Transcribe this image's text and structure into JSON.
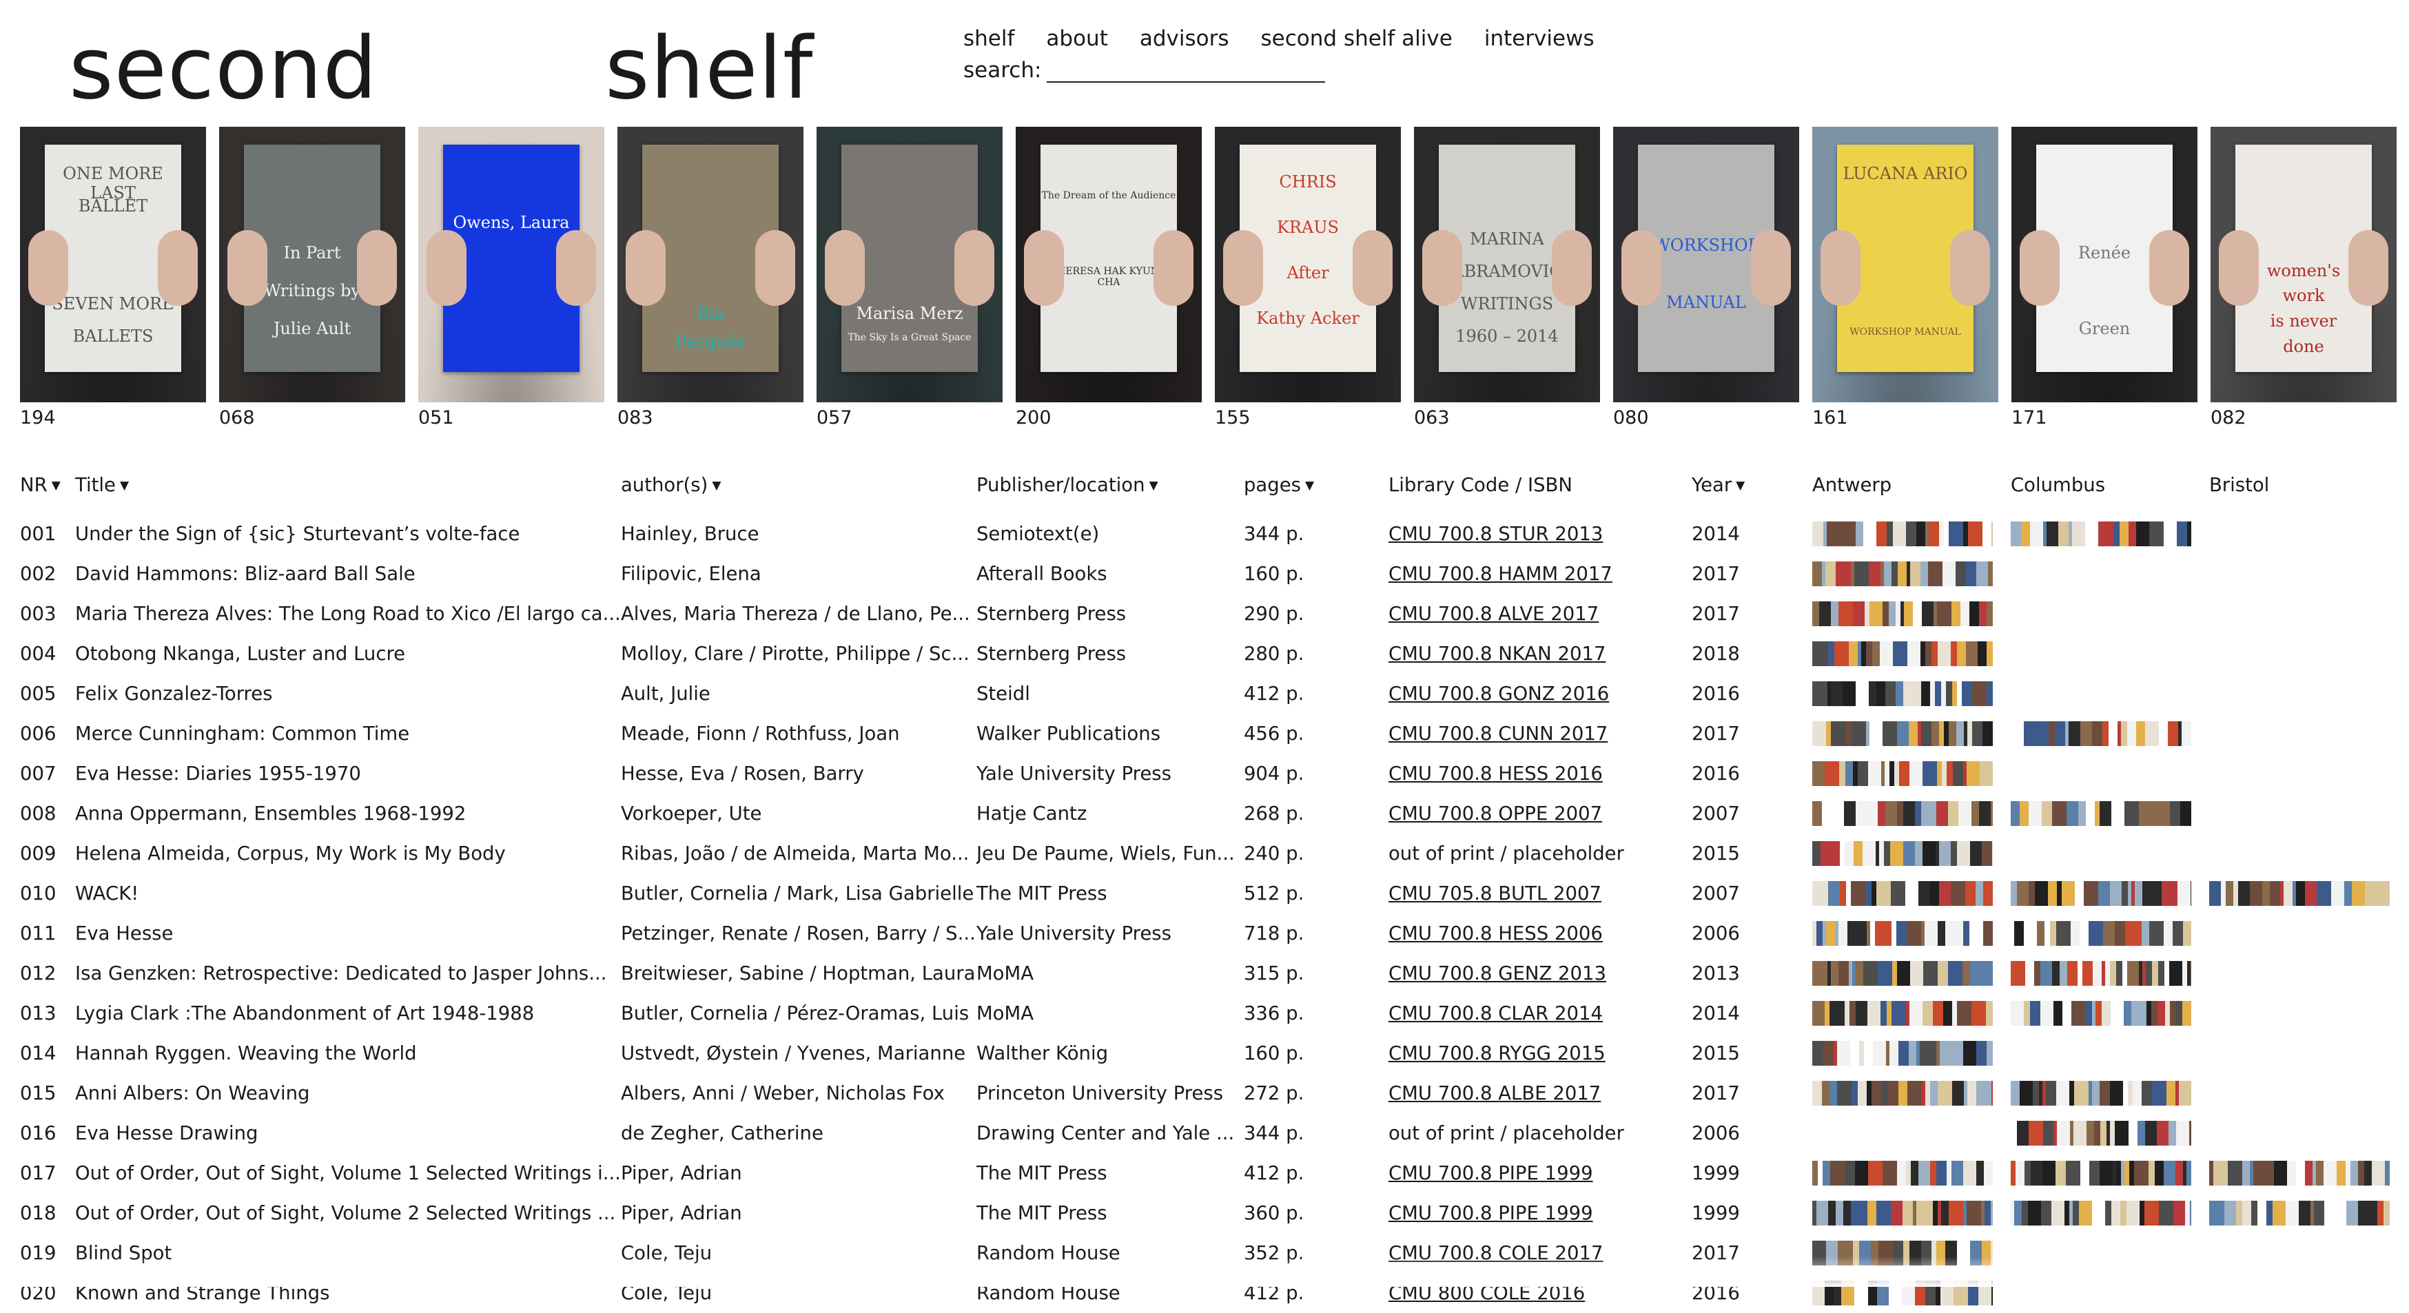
{
  "site": {
    "logo_left": "second",
    "logo_right": "shelf"
  },
  "nav": [
    "shelf",
    "about",
    "advisors",
    "second shelf alive",
    "interviews"
  ],
  "search": {
    "label": "search:",
    "value": ""
  },
  "covers": [
    {
      "num": "194",
      "bg": "#2a2a2a",
      "book": "#e6e6e3",
      "ink": "#555",
      "lines": [
        "ONE MORE LAST",
        "BALLET",
        "",
        "",
        "SEVEN MORE",
        "BALLETS"
      ]
    },
    {
      "num": "068",
      "bg": "#33302e",
      "book": "#6e7474",
      "ink": "#f0f0f0",
      "lines": [
        "",
        "",
        "In Part",
        "Writings by",
        "Julie Ault"
      ]
    },
    {
      "num": "051",
      "bg": "#d9cfc6",
      "book": "#1437e0",
      "ink": "#ffffff",
      "lines": [
        "Owens, Laura"
      ]
    },
    {
      "num": "083",
      "bg": "#3a3a3a",
      "book": "#8c8068",
      "ink": "#1fb1b0",
      "lines": [
        "",
        "",
        "",
        "",
        "",
        "Ria",
        "Pacquée"
      ]
    },
    {
      "num": "057",
      "bg": "#2d3a3a",
      "book": "#7a7672",
      "ink": "#f5f5f5",
      "lines": [
        "",
        "",
        "",
        "",
        "",
        "Marisa Merz",
        "The Sky Is a Great Space"
      ]
    },
    {
      "num": "200",
      "bg": "#23201f",
      "book": "#e8e6e2",
      "ink": "#333",
      "lines": [
        "The Dream of the Audience",
        "THERESA HAK KYUNG CHA"
      ]
    },
    {
      "num": "155",
      "bg": "#28282b",
      "book": "#efece6",
      "ink": "#c93a2a",
      "lines": [
        "CHRIS",
        "KRAUS",
        "After",
        "Kathy Acker"
      ]
    },
    {
      "num": "063",
      "bg": "#2b2b2b",
      "book": "#d1d0ca",
      "ink": "#5a5a5a",
      "lines": [
        "",
        "",
        "MARINA",
        "ABRAMOVIĆ",
        "WRITINGS",
        "1960 – 2014"
      ]
    },
    {
      "num": "080",
      "bg": "#2f2f33",
      "book": "#b6b6b4",
      "ink": "#2b5ad6",
      "lines": [
        "",
        "WORKSHOP",
        "MANUAL"
      ]
    },
    {
      "num": "161",
      "bg": "#7d93a4",
      "book": "#ecd24a",
      "ink": "#7a5a30",
      "lines": [
        "LUCANA ARIO",
        "",
        "",
        "",
        "",
        "WORKSHOP MANUAL"
      ]
    },
    {
      "num": "171",
      "bg": "#262626",
      "book": "#f1f1ef",
      "ink": "#777",
      "lines": [
        "",
        "",
        "Renée",
        "",
        "Green"
      ]
    },
    {
      "num": "082",
      "bg": "#4a4a4a",
      "book": "#ece9e5",
      "ink": "#b02a1e",
      "lines": [
        "",
        "",
        "",
        "",
        "women's",
        "work",
        "is never",
        "done"
      ]
    }
  ],
  "table": {
    "headers": {
      "nr": "NR",
      "title": "Title",
      "author": "author(s)",
      "publisher": "Publisher/location",
      "pages": "pages",
      "library": "Library Code / ISBN",
      "year": "Year",
      "antwerp": "Antwerp",
      "columbus": "Columbus",
      "bristol": "Bristol"
    },
    "rows": [
      {
        "nr": "001",
        "title": "Under the Sign of {sic} Sturtevant’s volte-face",
        "author": "Hainley, Bruce",
        "publisher": "Semiotext(e)",
        "pages": "344 p.",
        "library": "CMU 700.8 STUR 2013",
        "year": "2014",
        "antwerp": true,
        "columbus": true,
        "bristol": false
      },
      {
        "nr": "002",
        "title": "David Hammons: Bliz-aard Ball Sale",
        "author": "Filipovic, Elena",
        "publisher": "Afterall Books",
        "pages": "160 p.",
        "library": "CMU 700.8 HAMM 2017",
        "year": "2017",
        "antwerp": true,
        "columbus": false,
        "bristol": false
      },
      {
        "nr": "003",
        "title": "Maria Thereza Alves: The Long Road to Xico /El largo ca...",
        "author": "Alves, Maria Thereza / de Llano, Pe...",
        "publisher": "Sternberg Press",
        "pages": "290 p.",
        "library": "CMU 700.8 ALVE 2017",
        "year": "2017",
        "antwerp": true,
        "columbus": false,
        "bristol": false
      },
      {
        "nr": "004",
        "title": "Otobong Nkanga, Luster and Lucre",
        "author": "Molloy, Clare / Pirotte, Philippe / Sc...",
        "publisher": "Sternberg Press",
        "pages": "280 p.",
        "library": "CMU 700.8 NKAN 2017",
        "year": "2018",
        "antwerp": true,
        "columbus": false,
        "bristol": false
      },
      {
        "nr": "005",
        "title": "Felix Gonzalez-Torres",
        "author": "Ault, Julie",
        "publisher": "Steidl",
        "pages": "412 p.",
        "library": "CMU 700.8 GONZ 2016",
        "year": "2016",
        "antwerp": true,
        "columbus": false,
        "bristol": false
      },
      {
        "nr": "006",
        "title": "Merce Cunningham: Common Time",
        "author": "Meade, Fionn / Rothfuss, Joan",
        "publisher": "Walker Publications",
        "pages": "456 p.",
        "library": "CMU 700.8 CUNN 2017",
        "year": "2017",
        "antwerp": true,
        "columbus": true,
        "bristol": false
      },
      {
        "nr": "007",
        "title": "Eva Hesse: Diaries 1955-1970",
        "author": "Hesse, Eva / Rosen, Barry",
        "publisher": "Yale University Press",
        "pages": "904 p.",
        "library": "CMU 700.8 HESS 2016",
        "year": "2016",
        "antwerp": true,
        "columbus": false,
        "bristol": false
      },
      {
        "nr": "008",
        "title": "Anna Oppermann, Ensembles 1968-1992",
        "author": "Vorkoeper, Ute",
        "publisher": "Hatje Cantz",
        "pages": "268 p.",
        "library": "CMU 700.8 OPPE 2007",
        "year": "2007",
        "antwerp": true,
        "columbus": true,
        "bristol": false
      },
      {
        "nr": "009",
        "title": "Helena Almeida, Corpus, My Work is My Body",
        "author": "Ribas, João / de Almeida, Marta Mo...",
        "publisher": "Jeu De Paume, Wiels, Fun...",
        "pages": "240 p.",
        "library": "out of print / placeholder",
        "year": "2015",
        "antwerp": true,
        "columbus": false,
        "bristol": false
      },
      {
        "nr": "010",
        "title": "WACK!",
        "author": "Butler, Cornelia / Mark, Lisa Gabrielle",
        "publisher": "The MIT Press",
        "pages": "512 p.",
        "library": "CMU 705.8 BUTL 2007",
        "year": "2007",
        "antwerp": true,
        "columbus": true,
        "bristol": true
      },
      {
        "nr": "011",
        "title": "Eva Hesse",
        "author": "Petzinger, Renate / Rosen, Barry / S...",
        "publisher": "Yale University Press",
        "pages": "718 p.",
        "library": "CMU 700.8 HESS 2006",
        "year": "2006",
        "antwerp": true,
        "columbus": true,
        "bristol": false
      },
      {
        "nr": "012",
        "title": "Isa Genzken: Retrospective: Dedicated to Jasper Johns...",
        "author": "Breitwieser, Sabine / Hoptman, Laura",
        "publisher": "MoMA",
        "pages": "315 p.",
        "library": "CMU 700.8 GENZ 2013",
        "year": "2013",
        "antwerp": true,
        "columbus": true,
        "bristol": false
      },
      {
        "nr": "013",
        "title": "Lygia Clark :The Abandonment of Art 1948-1988",
        "author": "Butler, Cornelia / Pérez-Oramas, Luis",
        "publisher": "MoMA",
        "pages": "336 p.",
        "library": "CMU 700.8 CLAR 2014",
        "year": "2014",
        "antwerp": true,
        "columbus": true,
        "bristol": false
      },
      {
        "nr": "014",
        "title": "Hannah Ryggen. Weaving the World",
        "author": "Ustvedt, Øystein / Yvenes, Marianne",
        "publisher": "Walther König",
        "pages": "160 p.",
        "library": "CMU 700.8 RYGG 2015",
        "year": "2015",
        "antwerp": true,
        "columbus": false,
        "bristol": false
      },
      {
        "nr": "015",
        "title": "Anni Albers: On Weaving",
        "author": "Albers, Anni / Weber, Nicholas Fox",
        "publisher": "Princeton University Press",
        "pages": "272 p.",
        "library": "CMU 700.8 ALBE 2017",
        "year": "2017",
        "antwerp": true,
        "columbus": true,
        "bristol": false
      },
      {
        "nr": "016",
        "title": "Eva Hesse Drawing",
        "author": "de Zegher, Catherine",
        "publisher": "Drawing Center and Yale ...",
        "pages": "344 p.",
        "library": "out of print / placeholder",
        "year": "2006",
        "antwerp": false,
        "columbus": true,
        "bristol": false
      },
      {
        "nr": "017",
        "title": "Out of Order, Out of Sight, Volume 1 Selected Writings i...",
        "author": "Piper, Adrian",
        "publisher": "The MIT Press",
        "pages": "412 p.",
        "library": "CMU 700.8 PIPE 1999",
        "year": "1999",
        "antwerp": true,
        "columbus": true,
        "bristol": true
      },
      {
        "nr": "018",
        "title": "Out of Order, Out of Sight, Volume 2 Selected Writings ...",
        "author": "Piper, Adrian",
        "publisher": "The MIT Press",
        "pages": "360 p.",
        "library": "CMU 700.8 PIPE 1999",
        "year": "1999",
        "antwerp": true,
        "columbus": true,
        "bristol": true
      },
      {
        "nr": "019",
        "title": "Blind Spot",
        "author": "Cole, Teju",
        "publisher": "Random House",
        "pages": "352 p.",
        "library": "CMU 700.8 COLE 2017",
        "year": "2017",
        "antwerp": true,
        "columbus": false,
        "bristol": false
      },
      {
        "nr": "020",
        "title": "Known and Strange Things",
        "author": "Cole, Teju",
        "publisher": "Random House",
        "pages": "412 p.",
        "library": "CMU 800 COLE 2016",
        "year": "2016",
        "antwerp": true,
        "columbus": false,
        "bristol": false
      }
    ]
  }
}
